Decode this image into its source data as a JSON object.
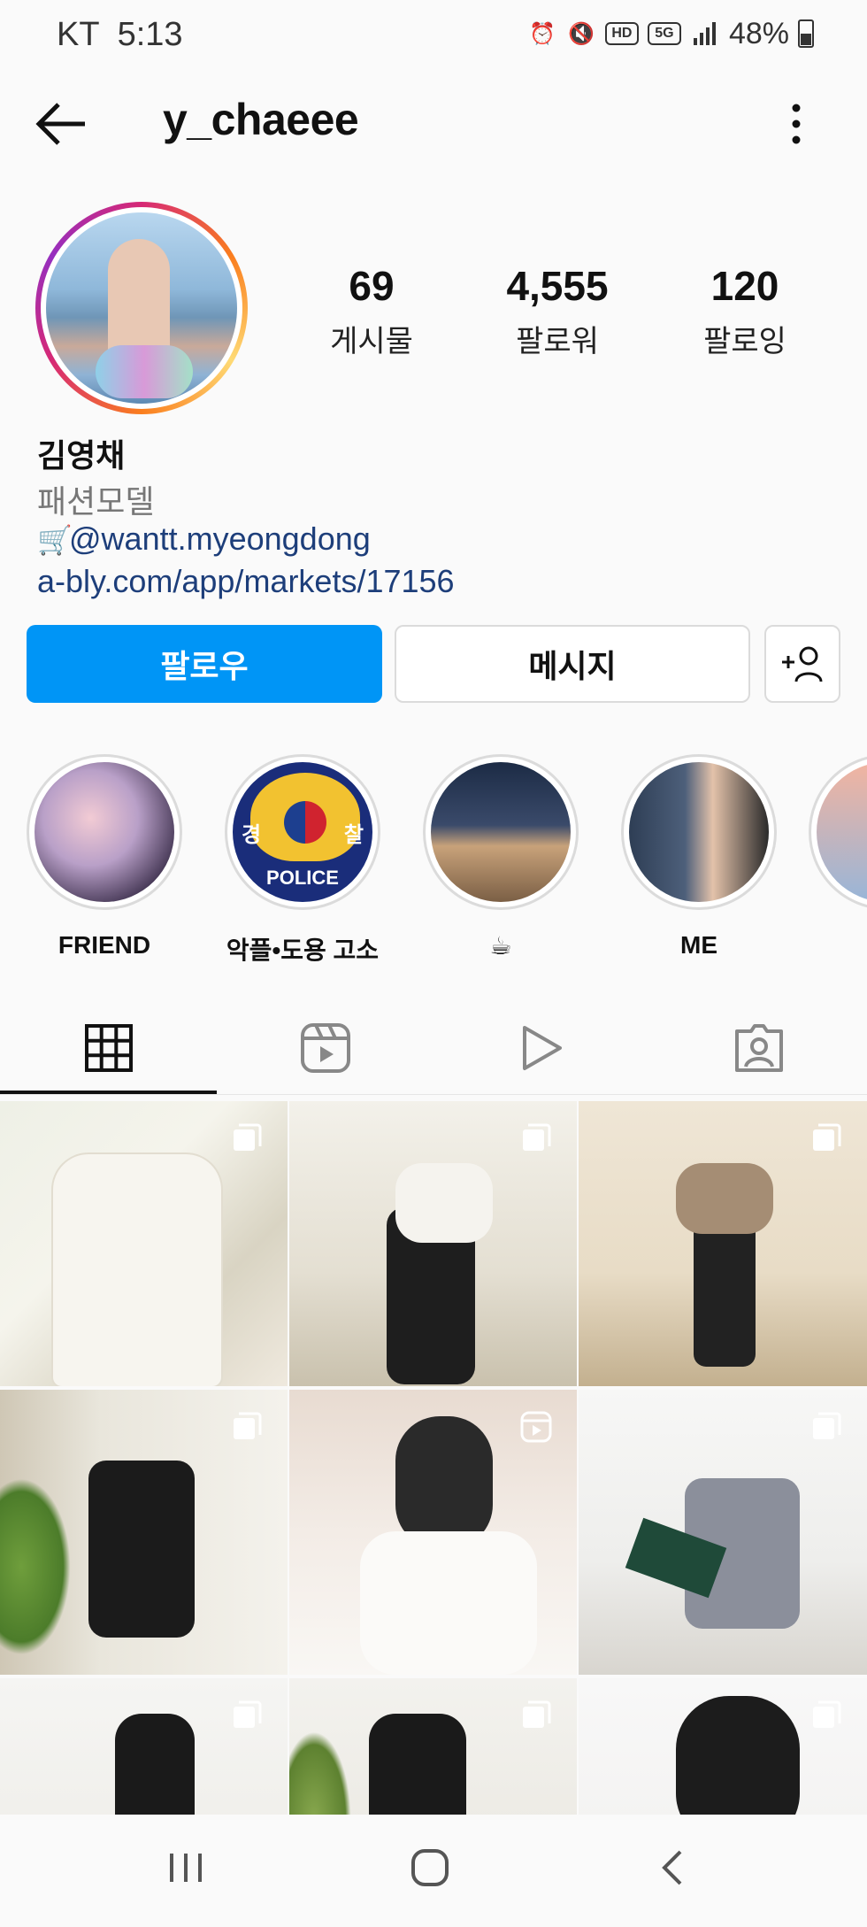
{
  "status_bar": {
    "carrier": "KT",
    "time": "5:13",
    "hd_label": "HD",
    "network_label": "5G",
    "battery": "48%"
  },
  "header": {
    "username": "y_chaeee"
  },
  "stats": [
    {
      "value": "69",
      "label": "게시물"
    },
    {
      "value": "4,555",
      "label": "팔로워"
    },
    {
      "value": "120",
      "label": "팔로잉"
    }
  ],
  "bio": {
    "name": "김영채",
    "category": "패션모델",
    "mention": "@wantt.myeongdong",
    "link": "a-bly.com/app/markets/17156"
  },
  "actions": {
    "follow_label": "팔로우",
    "message_label": "메시지"
  },
  "highlights": [
    {
      "label": "FRIEND"
    },
    {
      "label": "악플•도용 고소",
      "police_left": "경",
      "police_right": "찰",
      "police_text": "POLICE"
    },
    {
      "label": "☕"
    },
    {
      "label": "ME"
    }
  ],
  "tabs": [
    {
      "name": "posts",
      "icon": "grid-icon",
      "active": true
    },
    {
      "name": "reels",
      "icon": "reels-icon",
      "active": false
    },
    {
      "name": "videos",
      "icon": "play-icon",
      "active": false
    },
    {
      "name": "tagged",
      "icon": "tagged-icon",
      "active": false
    }
  ],
  "grid": [
    {
      "badge": "multi"
    },
    {
      "badge": "multi"
    },
    {
      "badge": "multi"
    },
    {
      "badge": "multi"
    },
    {
      "badge": "reel"
    },
    {
      "badge": "multi"
    },
    {
      "badge": "multi"
    },
    {
      "badge": "multi"
    },
    {
      "badge": "multi"
    }
  ],
  "colors": {
    "accent": "#0095f6",
    "link": "#1d3e7a",
    "border": "#dbdbdb"
  }
}
